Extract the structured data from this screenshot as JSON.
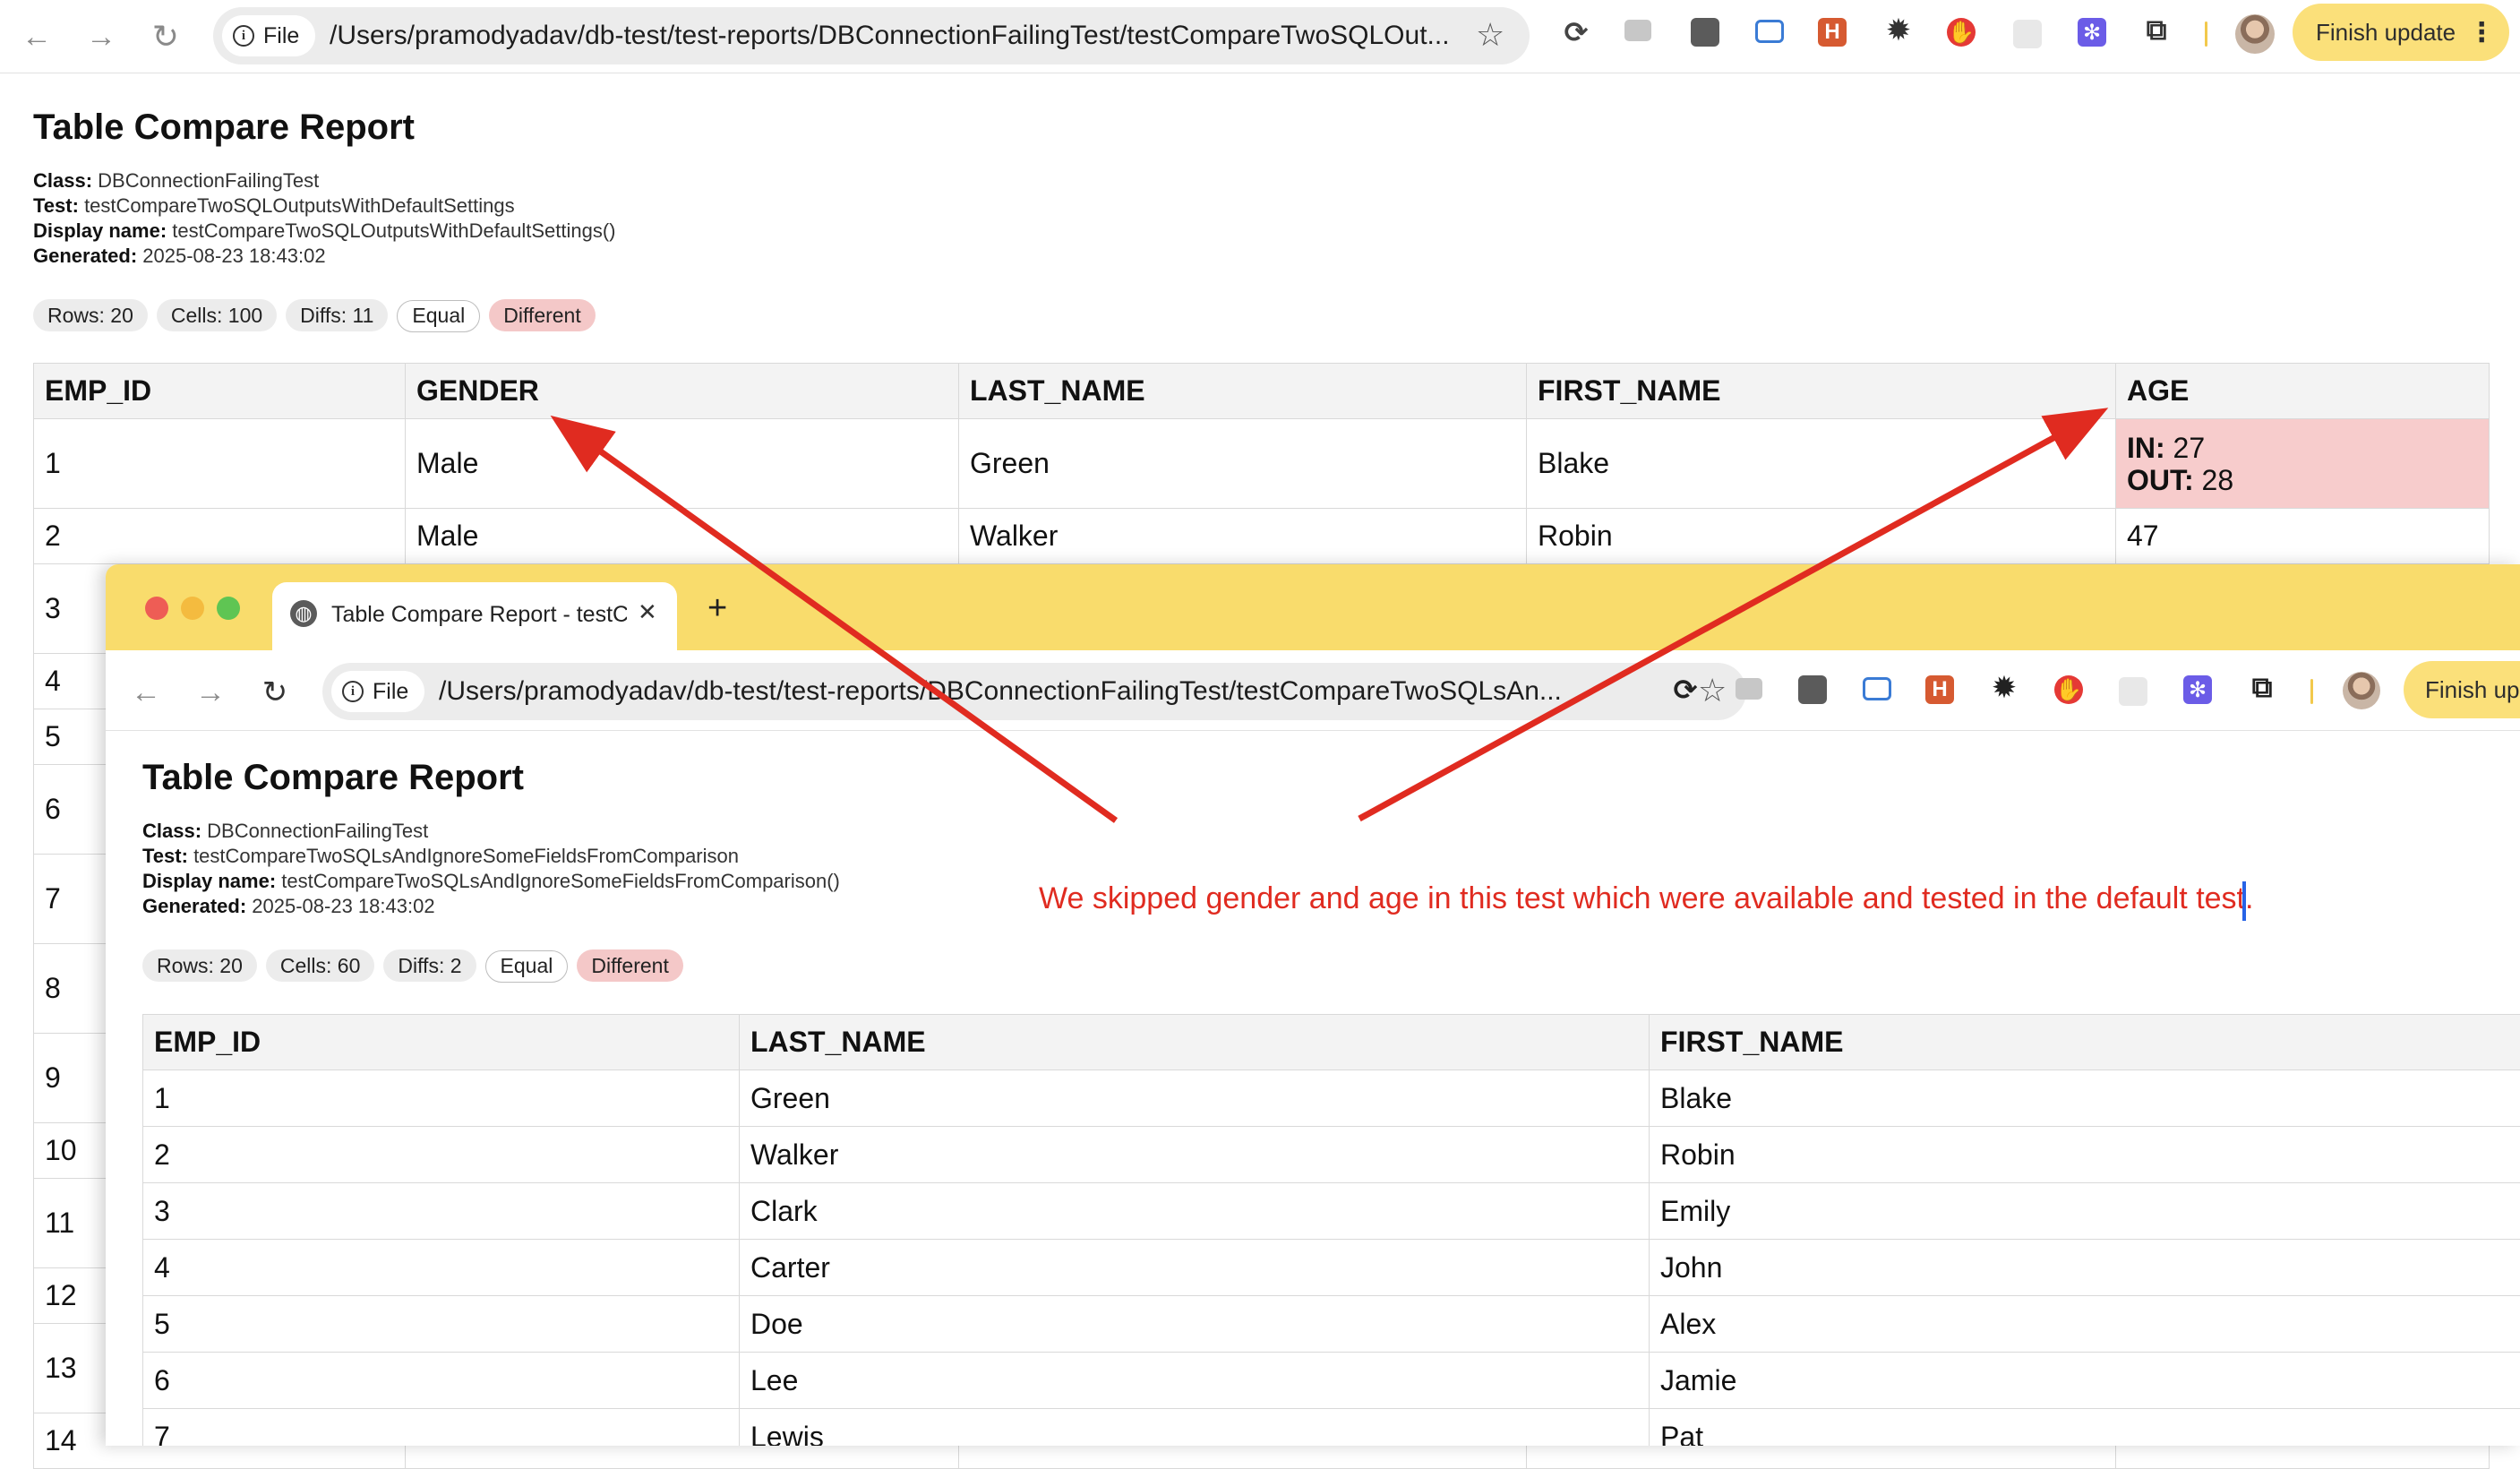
{
  "back_window": {
    "toolbar": {
      "back_icon": "arrow-left-icon",
      "forward_icon": "arrow-right-icon",
      "reload_icon": "reload-icon",
      "file_chip": "File",
      "url": "/Users/pramodyadav/db-test/test-reports/DBConnectionFailingTest/testCompareTwoSQLOut...",
      "finish_update": "Finish update"
    },
    "report": {
      "title": "Table Compare Report",
      "meta": {
        "class_label": "Class:",
        "class_value": "DBConnectionFailingTest",
        "test_label": "Test:",
        "test_value": "testCompareTwoSQLOutputsWithDefaultSettings",
        "display_label": "Display name:",
        "display_value": "testCompareTwoSQLOutputsWithDefaultSettings()",
        "generated_label": "Generated:",
        "generated_value": "2025-08-23 18:43:02"
      },
      "pills": {
        "rows": "Rows: 20",
        "cells": "Cells: 100",
        "diffs": "Diffs: 11",
        "equal": "Equal",
        "different": "Different"
      },
      "columns": [
        "EMP_ID",
        "GENDER",
        "LAST_NAME",
        "FIRST_NAME",
        "AGE"
      ],
      "row1": {
        "emp_id": "1",
        "gender": "Male",
        "last_name": "Green",
        "first_name": "Blake",
        "age_in_label": "IN:",
        "age_in": "27",
        "age_out_label": "OUT:",
        "age_out": "28"
      },
      "row2": {
        "emp_id": "2",
        "gender": "Male",
        "last_name": "Walker",
        "first_name": "Robin",
        "age": "47"
      },
      "left_ids": [
        "3",
        "4",
        "5",
        "6",
        "7",
        "8",
        "9",
        "10",
        "11",
        "12",
        "13",
        "14"
      ]
    }
  },
  "front_window": {
    "tab_title": "Table Compare Report - testC",
    "new_tab": "+",
    "tab_close": "✕",
    "toolbar": {
      "file_chip": "File",
      "url": "/Users/pramodyadav/db-test/test-reports/DBConnectionFailingTest/testCompareTwoSQLsAn...",
      "finish_update": "Finish up"
    },
    "report": {
      "title": "Table Compare Report",
      "meta": {
        "class_label": "Class:",
        "class_value": "DBConnectionFailingTest",
        "test_label": "Test:",
        "test_value": "testCompareTwoSQLsAndIgnoreSomeFieldsFromComparison",
        "display_label": "Display name:",
        "display_value": "testCompareTwoSQLsAndIgnoreSomeFieldsFromComparison()",
        "generated_label": "Generated:",
        "generated_value": "2025-08-23 18:43:02"
      },
      "pills": {
        "rows": "Rows: 20",
        "cells": "Cells: 60",
        "diffs": "Diffs: 2",
        "equal": "Equal",
        "different": "Different"
      },
      "columns": [
        "EMP_ID",
        "LAST_NAME",
        "FIRST_NAME"
      ],
      "rows": [
        [
          "1",
          "Green",
          "Blake"
        ],
        [
          "2",
          "Walker",
          "Robin"
        ],
        [
          "3",
          "Clark",
          "Emily"
        ],
        [
          "4",
          "Carter",
          "John"
        ],
        [
          "5",
          "Doe",
          "Alex"
        ],
        [
          "6",
          "Lee",
          "Jamie"
        ],
        [
          "7",
          "Lewis",
          "Pat"
        ]
      ]
    }
  },
  "annotation": {
    "note": "We skipped gender and age in this test which were available and tested in the default test.",
    "color": "#e02b20"
  }
}
